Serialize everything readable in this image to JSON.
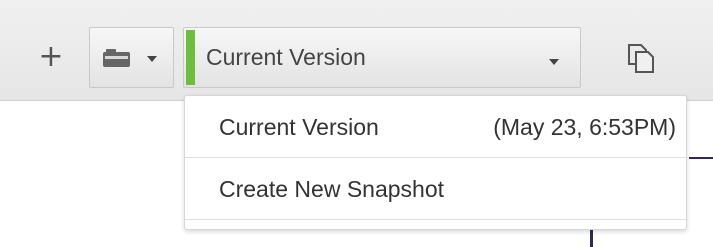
{
  "toolbar": {
    "add_label": "+",
    "version_select": {
      "selected_value": "Current Version",
      "color": "#6cbe3c"
    }
  },
  "dropdown": {
    "items": [
      {
        "label": "Current Version",
        "timestamp": "(May 23, 6:53PM)"
      },
      {
        "label": "Create New Snapshot"
      }
    ]
  },
  "icons": [
    "add-icon",
    "folder-icon",
    "chevron-down-icon",
    "copy-icon"
  ]
}
